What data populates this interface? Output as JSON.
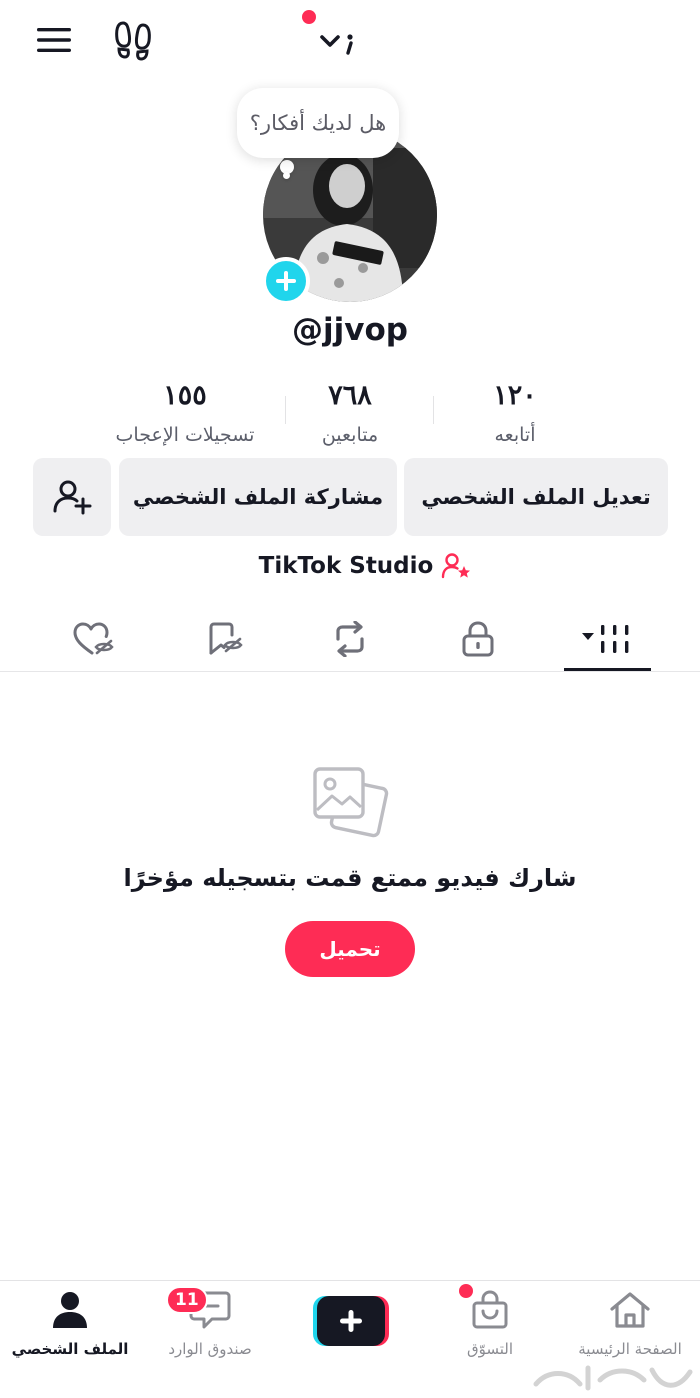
{
  "top_bar": {
    "menu_icon": "hamburger-menu-icon",
    "footprint_icon": "footprints-icon",
    "nowpost_icon": "now-post-icon"
  },
  "profile": {
    "bubble_text": "هل لديك أفكار؟",
    "username": "@jjvop",
    "stats": {
      "following": {
        "value": "١٢٠",
        "label": "أتابعه"
      },
      "followers": {
        "value": "٧٦٨",
        "label": "متابعين"
      },
      "likes": {
        "value": "١٥٥",
        "label": "تسجيلات الإعجاب"
      }
    },
    "buttons": {
      "edit": "تعديل الملف الشخصي",
      "share": "مشاركة الملف الشخصي"
    },
    "studio_label": "TikTok Studio"
  },
  "tabs": [
    {
      "name": "videos",
      "icon": "grid-icon",
      "active": true
    },
    {
      "name": "private",
      "icon": "lock-icon",
      "active": false
    },
    {
      "name": "reposts",
      "icon": "repost-icon",
      "active": false
    },
    {
      "name": "favorites",
      "icon": "bookmark-hidden-icon",
      "active": false
    },
    {
      "name": "liked",
      "icon": "heart-hidden-icon",
      "active": false
    }
  ],
  "empty_state": {
    "message": "شارك فيديو ممتع قمت بتسجيله مؤخرًا",
    "upload_label": "تحميل"
  },
  "bottom_nav": {
    "home": "الصفحة الرئيسية",
    "shop": "التسوّق",
    "inbox": "صندوق الوارد",
    "inbox_badge": "11",
    "profile": "الملف الشخصي"
  },
  "colors": {
    "accent": "#fe2c55",
    "cyan": "#20d5ec",
    "text": "#161823",
    "button_bg": "#efeff1"
  }
}
